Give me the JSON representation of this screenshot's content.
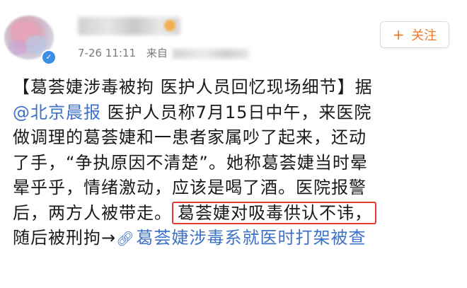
{
  "post": {
    "time": "7-26 11:11",
    "from_prefix": "来自"
  },
  "follow_button": {
    "plus": "+",
    "label": "关注"
  },
  "content": {
    "line1": "【葛荟婕涉毒被拘 医护人员回忆现场细节】据",
    "mention": "@北京晨报",
    "line2_rest": " 医护人员称7月15日中午，来医院",
    "line3": "做调理的葛荟婕和一患者家属吵了起来，还动",
    "line4": "了手，“争执原因不清楚”。她称葛荟婕当时晕",
    "line5": "晕乎乎，情绪激动，应该是喝了酒。医院报警",
    "line6_pre": "后，两方人被带走。",
    "highlight": "葛荟婕对吸毒供认不讳，",
    "line7_pre": "随后被刑拘→",
    "link_icon": "link-icon",
    "link_text": "葛荟婕涉毒系就医时打架被查"
  },
  "colors": {
    "link": "#3d72c7",
    "follow": "#f07a28",
    "highlight_border": "#e53935"
  }
}
